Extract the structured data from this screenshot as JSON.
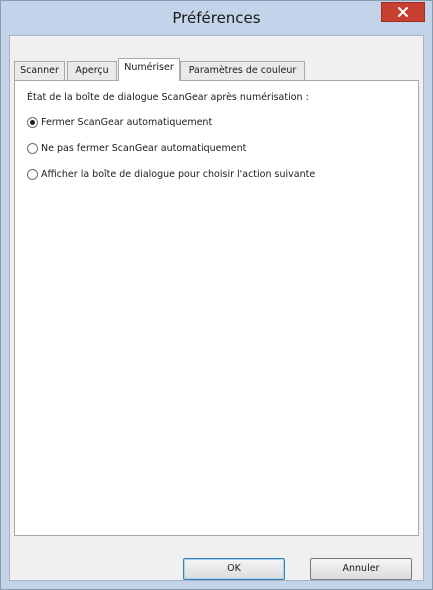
{
  "window": {
    "title": "Préférences",
    "close_icon": "close-icon"
  },
  "tabs": [
    {
      "label": "Scanner",
      "active": false
    },
    {
      "label": "Aperçu",
      "active": false
    },
    {
      "label": "Numériser",
      "active": true
    },
    {
      "label": "Paramètres de couleur",
      "active": false
    }
  ],
  "scan_tab": {
    "group_label": "État de la boîte de dialogue ScanGear après numérisation :",
    "options": [
      {
        "label": "Fermer ScanGear automatiquement",
        "checked": true
      },
      {
        "label": "Ne pas fermer ScanGear automatiquement",
        "checked": false
      },
      {
        "label": "Afficher la boîte de dialogue pour choisir l'action suivante",
        "checked": false
      }
    ]
  },
  "buttons": {
    "ok_label": "OK",
    "cancel_label": "Annuler"
  },
  "colors": {
    "titlebar": "#c3d4ea",
    "close_button": "#c7402f",
    "panel": "#ffffff",
    "client": "#f0f0f0"
  }
}
